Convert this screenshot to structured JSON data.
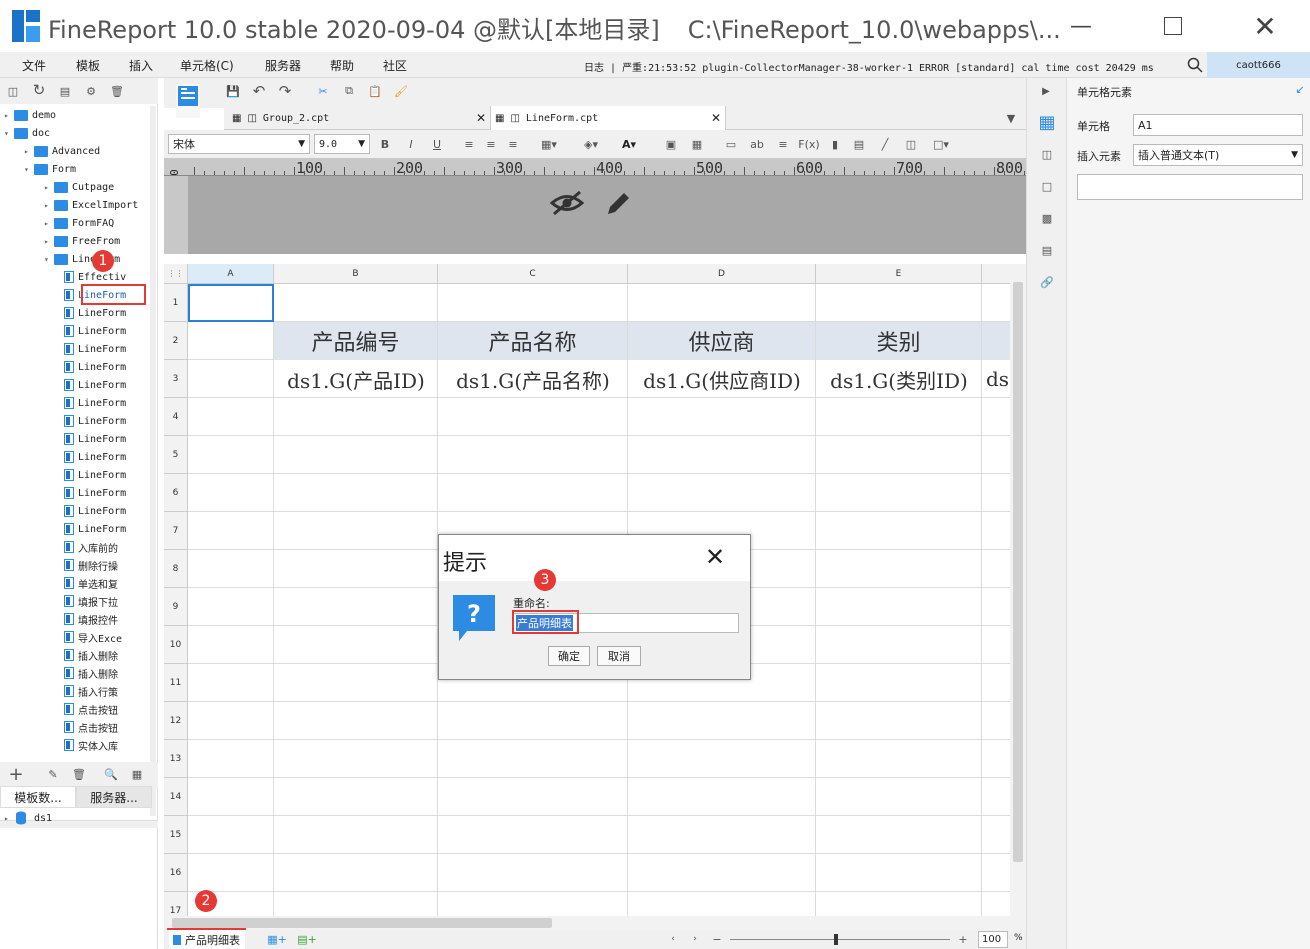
{
  "app": {
    "title": "FineReport 10.0 stable 2020-09-04 @默认[本地目录]",
    "path": "C:\\FineReport_10.0\\webapps\\...",
    "logo_color": "#1a73c9"
  },
  "menu": [
    "文件",
    "模板",
    "插入",
    "单元格(C)",
    "服务器",
    "帮助",
    "社区"
  ],
  "log": {
    "label": "日志",
    "text": "严重:21:53:52 plugin-CollectorManager-38-worker-1 ERROR [standard] cal time cost 20429 ms"
  },
  "user": "caott666",
  "tree": {
    "items": [
      {
        "label": "demo",
        "kind": "folder",
        "level": 0,
        "arrow": "▸"
      },
      {
        "label": "doc",
        "kind": "folder",
        "level": 0,
        "arrow": "▾"
      },
      {
        "label": "Advanced",
        "kind": "folder",
        "level": 1,
        "arrow": "▸"
      },
      {
        "label": "Form",
        "kind": "folder",
        "level": 1,
        "arrow": "▾"
      },
      {
        "label": "Cutpage",
        "kind": "folder",
        "level": 2,
        "arrow": "▸"
      },
      {
        "label": "ExcelImport",
        "kind": "folder",
        "level": 2,
        "arrow": "▸"
      },
      {
        "label": "FormFAQ",
        "kind": "folder",
        "level": 2,
        "arrow": "▸"
      },
      {
        "label": "FreeFrom",
        "kind": "folder",
        "level": 2,
        "arrow": "▸"
      },
      {
        "label": "LineForm",
        "kind": "folder",
        "level": 2,
        "arrow": "▾"
      },
      {
        "label": "Effectiv",
        "kind": "file",
        "level": 3
      },
      {
        "label": "LineForm",
        "kind": "file",
        "level": 3,
        "selected": true
      },
      {
        "label": "LineForm",
        "kind": "file",
        "level": 3
      },
      {
        "label": "LineForm",
        "kind": "file",
        "level": 3
      },
      {
        "label": "LineForm",
        "kind": "file",
        "level": 3
      },
      {
        "label": "LineForm",
        "kind": "file",
        "level": 3
      },
      {
        "label": "LineForm",
        "kind": "file",
        "level": 3
      },
      {
        "label": "LineForm",
        "kind": "file",
        "level": 3
      },
      {
        "label": "LineForm",
        "kind": "file",
        "level": 3
      },
      {
        "label": "LineForm",
        "kind": "file",
        "level": 3
      },
      {
        "label": "LineForm",
        "kind": "file",
        "level": 3
      },
      {
        "label": "LineForm",
        "kind": "file",
        "level": 3
      },
      {
        "label": "LineForm",
        "kind": "file",
        "level": 3
      },
      {
        "label": "LineForm",
        "kind": "file",
        "level": 3
      },
      {
        "label": "LineForm",
        "kind": "file",
        "level": 3
      },
      {
        "label": "入库前的",
        "kind": "file",
        "level": 3
      },
      {
        "label": "删除行操",
        "kind": "file",
        "level": 3
      },
      {
        "label": "单选和复",
        "kind": "file",
        "level": 3
      },
      {
        "label": "填报下拉",
        "kind": "file",
        "level": 3
      },
      {
        "label": "填报控件",
        "kind": "file",
        "level": 3
      },
      {
        "label": "导入Exce",
        "kind": "file",
        "level": 3
      },
      {
        "label": "插入删除",
        "kind": "file",
        "level": 3
      },
      {
        "label": "插入删除",
        "kind": "file",
        "level": 3
      },
      {
        "label": "插入行策",
        "kind": "file",
        "level": 3
      },
      {
        "label": "点击按钮",
        "kind": "file",
        "level": 3
      },
      {
        "label": "点击按钮",
        "kind": "file",
        "level": 3
      },
      {
        "label": "实体入库",
        "kind": "file",
        "level": 3
      }
    ]
  },
  "left_bottom": {
    "tabs": [
      "模板数...",
      "服务器..."
    ],
    "datasource": "ds1"
  },
  "tabs": [
    {
      "label": "Group_2.cpt"
    },
    {
      "label": "LineForm.cpt"
    }
  ],
  "format": {
    "font": "宋体",
    "size": "9.0"
  },
  "ruler": [
    "100",
    "200",
    "300",
    "400",
    "500",
    "600",
    "700",
    "800"
  ],
  "ruler_zero": "0",
  "columns": [
    "A",
    "B",
    "C",
    "D",
    "E"
  ],
  "rows": [
    "1",
    "2",
    "3",
    "4",
    "5",
    "6",
    "7",
    "8",
    "9",
    "10",
    "11",
    "12",
    "13",
    "14",
    "15",
    "16",
    "17"
  ],
  "headers": [
    "产品编号",
    "产品名称",
    "供应商",
    "类别"
  ],
  "data_cells": [
    "ds1.G(产品ID)",
    "ds1.G(产品名称)",
    "ds1.G(供应商ID)",
    "ds1.G(类别ID)",
    "ds"
  ],
  "right_panel": {
    "title": "单元格元素",
    "cell_label": "单元格",
    "cell_value": "A1",
    "insert_label": "插入元素",
    "insert_value": "插入普通文本(T)"
  },
  "dialog": {
    "title": "提示",
    "label": "重命名:",
    "value": "产品明细表",
    "ok": "确定",
    "cancel": "取消"
  },
  "sheet_tab": "产品明细表",
  "zoom": "100",
  "zoom_unit": "%",
  "badges": [
    "1",
    "2",
    "3"
  ]
}
